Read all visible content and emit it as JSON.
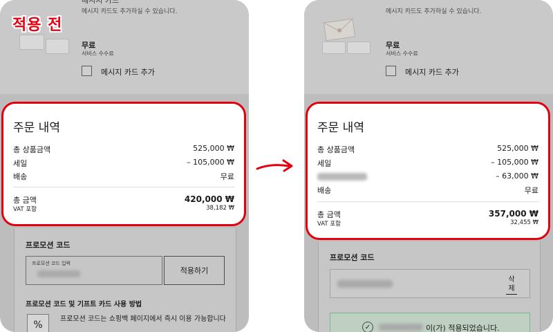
{
  "before": {
    "badge": "적용 전",
    "top_cut_title": "메시지 카드",
    "top_cut_text": "메시지 카드도 추가하실 수 있습니다.",
    "free_title": "무료",
    "free_sub": "서비스 수수료",
    "message_card_label": "메시지 카드 추가",
    "order_title": "주문 내역",
    "rows": [
      {
        "label": "총 상품금액",
        "value": "525,000 ₩"
      },
      {
        "label": "세일",
        "value": "– 105,000 ₩"
      },
      {
        "label": "배송",
        "value": "무료"
      }
    ],
    "total_label": "총 금액",
    "total_value": "420,000 ₩",
    "vat_label": "VAT 포함",
    "vat_value": "38,182 ₩",
    "promo_title": "프로모션 코드",
    "promo_placeholder": "프로모션 코드 입력",
    "apply_label": "적용하기",
    "how_title": "프로모션 코드 및 기프트 카드 사용 방법",
    "how_icon": "%",
    "how_text": "프로모션 코드는 쇼핑백 페이지에서 즉시 이용 가능합니다"
  },
  "after": {
    "top_cut_text": "메시지 카드도 추가하실 수 있습니다.",
    "free_title": "무료",
    "free_sub": "서비스 수수료",
    "message_card_label": "메시지 카드 추가",
    "order_title": "주문 내역",
    "rows": [
      {
        "label": "총 상품금액",
        "value": "525,000 ₩"
      },
      {
        "label": "세일",
        "value": "– 105,000 ₩"
      },
      {
        "label": "",
        "value": "– 63,000 ₩"
      },
      {
        "label": "배송",
        "value": "무료"
      }
    ],
    "total_label": "총 금액",
    "total_value": "357,000 ₩",
    "vat_label": "VAT 포함",
    "vat_value": "32,455 ₩",
    "promo_title": "프로모션 코드",
    "delete_label": "삭제",
    "success_text": "이(가) 적용되었습니다."
  },
  "colors": {
    "highlight_red": "#e3000f",
    "dim_overlay": "#bdbdbd"
  }
}
